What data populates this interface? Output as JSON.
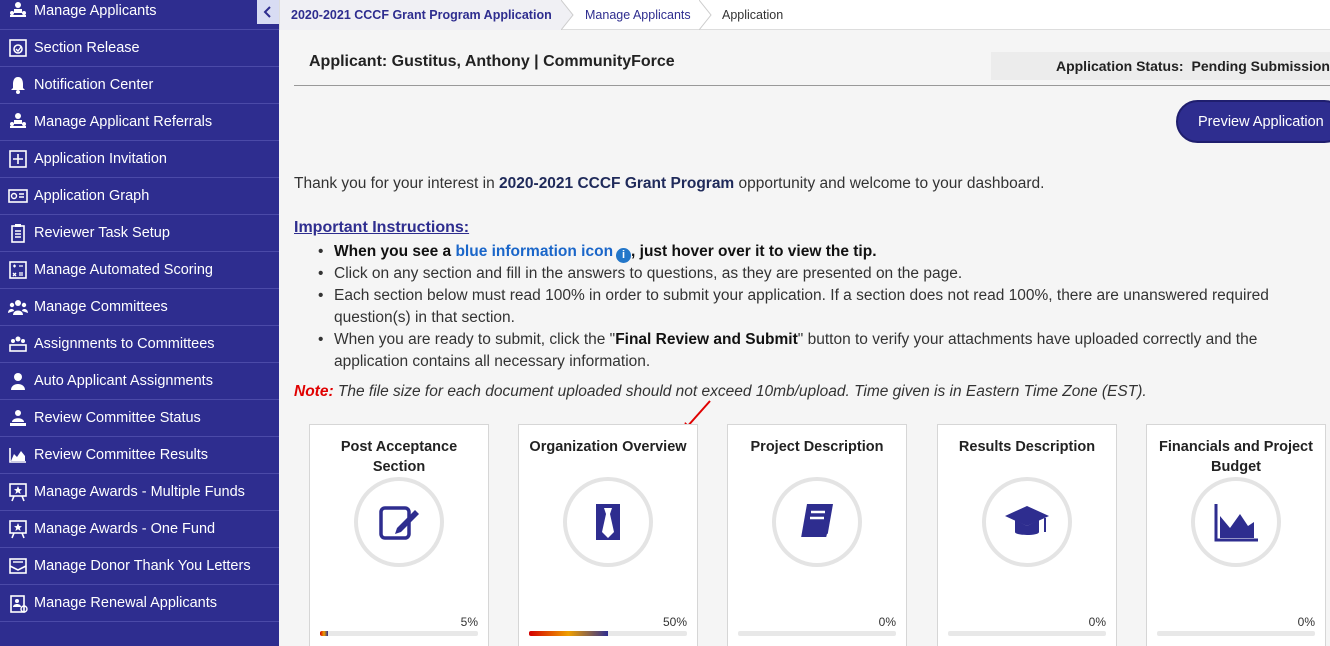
{
  "sidebar": {
    "items": [
      {
        "label": "Manage Applicants",
        "icon": "people-tree-icon"
      },
      {
        "label": "Section Release",
        "icon": "section-release-icon"
      },
      {
        "label": "Notification Center",
        "icon": "bell-icon"
      },
      {
        "label": "Manage Applicant Referrals",
        "icon": "people-tree-icon"
      },
      {
        "label": "Application Invitation",
        "icon": "plus-box-icon"
      },
      {
        "label": "Application Graph",
        "icon": "graph-card-icon"
      },
      {
        "label": "Reviewer Task Setup",
        "icon": "clipboard-icon"
      },
      {
        "label": "Manage Automated Scoring",
        "icon": "scoring-icon"
      },
      {
        "label": "Manage Committees",
        "icon": "group-icon"
      },
      {
        "label": "Assignments to Committees",
        "icon": "committee-assign-icon"
      },
      {
        "label": "Auto Applicant Assignments",
        "icon": "user-icon"
      },
      {
        "label": "Review Committee Status",
        "icon": "review-status-icon"
      },
      {
        "label": "Review Committee Results",
        "icon": "area-chart-icon"
      },
      {
        "label": "Manage Awards - Multiple Funds",
        "icon": "award-star-icon"
      },
      {
        "label": "Manage Awards - One Fund",
        "icon": "award-star-icon"
      },
      {
        "label": "Manage Donor Thank You Letters",
        "icon": "letter-icon"
      },
      {
        "label": "Manage Renewal Applicants",
        "icon": "renewal-icon"
      }
    ]
  },
  "breadcrumb": {
    "program": "2020-2021 CCCF Grant Program Application",
    "manage": "Manage Applicants",
    "current": "Application"
  },
  "header": {
    "applicant": "Applicant: Gustitus, Anthony | CommunityForce",
    "status_label": "Application Status:",
    "status_value": "Pending Submission",
    "preview_label": "Preview Application"
  },
  "intro": {
    "prefix": "Thank you for your interest in ",
    "program": "2020-2021 CCCF Grant Program",
    "suffix": " opportunity and welcome to your dashboard."
  },
  "instructions": {
    "heading": "Important Instructions:",
    "item1_prefix": "When you see a ",
    "item1_link": "blue information icon",
    "item1_suffix": ", just hover over it to view the tip.",
    "item2": "Click on any section and fill in the answers to questions, as they are presented on the page.",
    "item3": "Each section below must read 100% in order to submit your application. If a section does not read 100%, there are unanswered required question(s) in that section.",
    "item4_prefix": "When you are ready to submit, click the \"",
    "item4_bold": "Final Review and Submit",
    "item4_suffix": "\" button to verify your attachments have uploaded correctly and the application contains all necessary information."
  },
  "note": {
    "label": "Note:",
    "text": " The file size for each document uploaded should not exceed 10mb/upload. Time given is in Eastern Time Zone (EST)."
  },
  "cards": [
    {
      "title": "Post Acceptance Section",
      "percent_label": "5%",
      "progress": 0.05,
      "icon": "edit-icon"
    },
    {
      "title": "Organization Overview",
      "percent_label": "50%",
      "progress": 0.5,
      "icon": "tie-icon"
    },
    {
      "title": "Project Description",
      "percent_label": "0%",
      "progress": 0.0,
      "icon": "book-icon"
    },
    {
      "title": "Results Description",
      "percent_label": "0%",
      "progress": 0.0,
      "icon": "graduation-cap-icon"
    },
    {
      "title": "Financials and Project Budget",
      "percent_label": "0%",
      "progress": 0.0,
      "icon": "area-chart-icon"
    }
  ],
  "colors": {
    "sidebar_bg": "#2e2d8f",
    "accent": "#2e2d8f",
    "note_red": "#e00000",
    "info_blue": "#1a66c9"
  }
}
